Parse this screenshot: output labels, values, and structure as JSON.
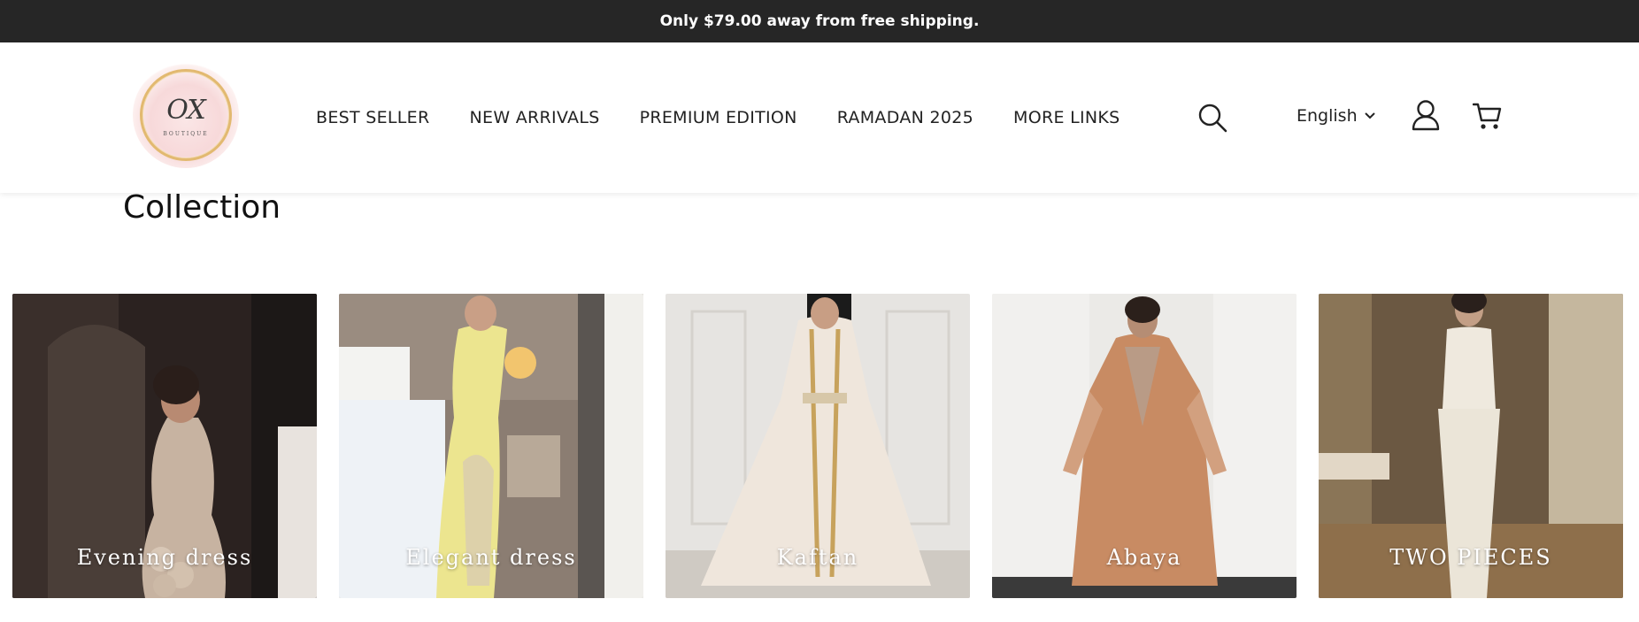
{
  "announcement": {
    "text": "Only $79.00 away from free shipping."
  },
  "header": {
    "logo": {
      "monogram": "OX",
      "subtitle": "BOUTIQUE"
    },
    "nav": [
      {
        "label": "BEST SELLER"
      },
      {
        "label": "NEW ARRIVALS"
      },
      {
        "label": "PREMIUM EDITION"
      },
      {
        "label": "RAMADAN 2025"
      },
      {
        "label": "MORE LINKS"
      }
    ],
    "search_icon": "search-icon",
    "language": {
      "selected": "English",
      "icon": "chevron-down-icon"
    },
    "account_icon": "user-icon",
    "cart_icon": "cart-icon"
  },
  "page": {
    "title": "Collection"
  },
  "collections": [
    {
      "label": "Evening dress",
      "theme": {
        "bg": "#2e2523",
        "dress": "#c8b5a4"
      }
    },
    {
      "label": "Elegant dress",
      "theme": {
        "bg": "#8c7e73",
        "dress": "#e6e08c"
      }
    },
    {
      "label": "Kaftan",
      "theme": {
        "bg": "#e8e6e3",
        "dress": "#e9dfd4"
      }
    },
    {
      "label": "Abaya",
      "theme": {
        "bg": "#ecebe9",
        "dress": "#c98d65"
      }
    },
    {
      "label": "TWO PIECES",
      "theme": {
        "bg": "#6d5a44",
        "dress": "#ece6db"
      }
    }
  ],
  "colors": {
    "announcement_bg": "#262626",
    "text": "#222222",
    "logo_gold": "#e2b970"
  }
}
